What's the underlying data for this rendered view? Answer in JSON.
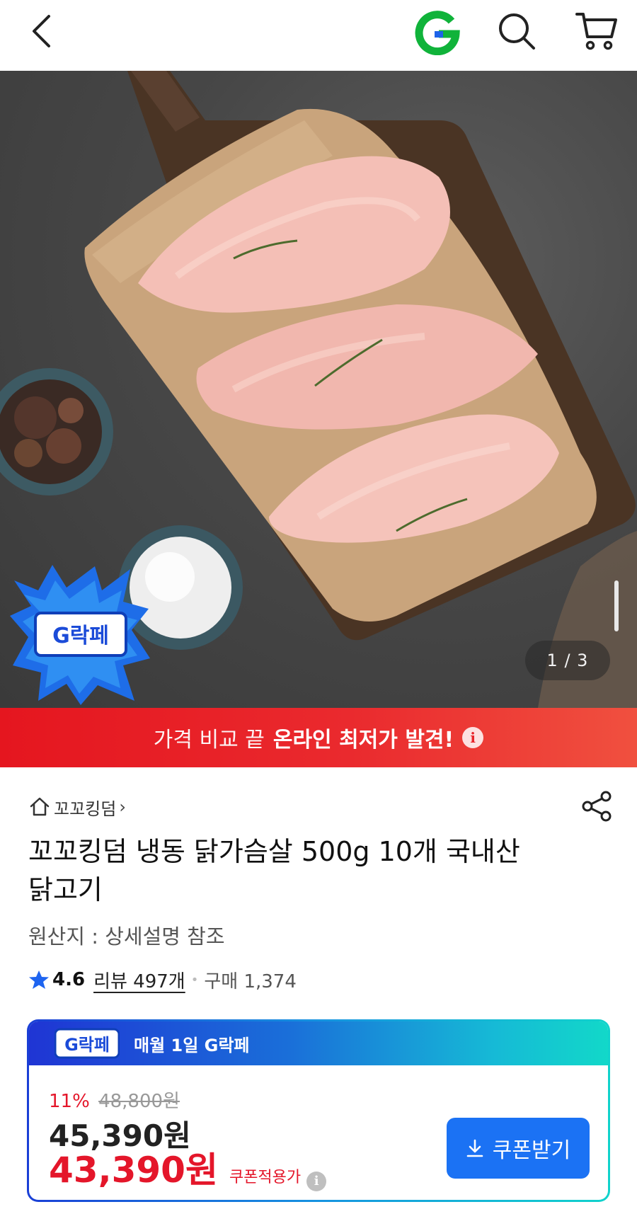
{
  "header": {
    "back_icon": "chevron-left-icon",
    "logo_letter": "G",
    "logo_color": "#10b33a",
    "search_icon": "search-icon",
    "cart_icon": "cart-icon"
  },
  "hero": {
    "page_indicator": "1 / 3",
    "badge_text": "G락페"
  },
  "promo": {
    "normal_text": "가격 비교 끝",
    "bold_text": "온라인 최저가 발견!",
    "info_icon": "i",
    "color": "#e5161f"
  },
  "product": {
    "store_name": "꼬꼬킹덤",
    "store_chevron": "›",
    "title": "꼬꼬킹덤 냉동 닭가슴살 500g 10개 국내산 닭고기",
    "origin": "원산지 : 상세설명 참조",
    "rating": "4.6",
    "review_text": "리뷰 497개",
    "dot": "•",
    "purchase_text": "구매 1,374"
  },
  "deal": {
    "logo_text": "G락페",
    "header_text": "매월 1일 G락페",
    "discount_pct": "11%",
    "original_price": "48,800원",
    "price": "45,390원",
    "coupon_price": "43,390원",
    "coupon_price_label": "쿠폰적용가",
    "info_icon": "i",
    "coupon_button": "쿠폰받기",
    "accent_red": "#e4162a",
    "button_blue": "#1b72f4"
  }
}
